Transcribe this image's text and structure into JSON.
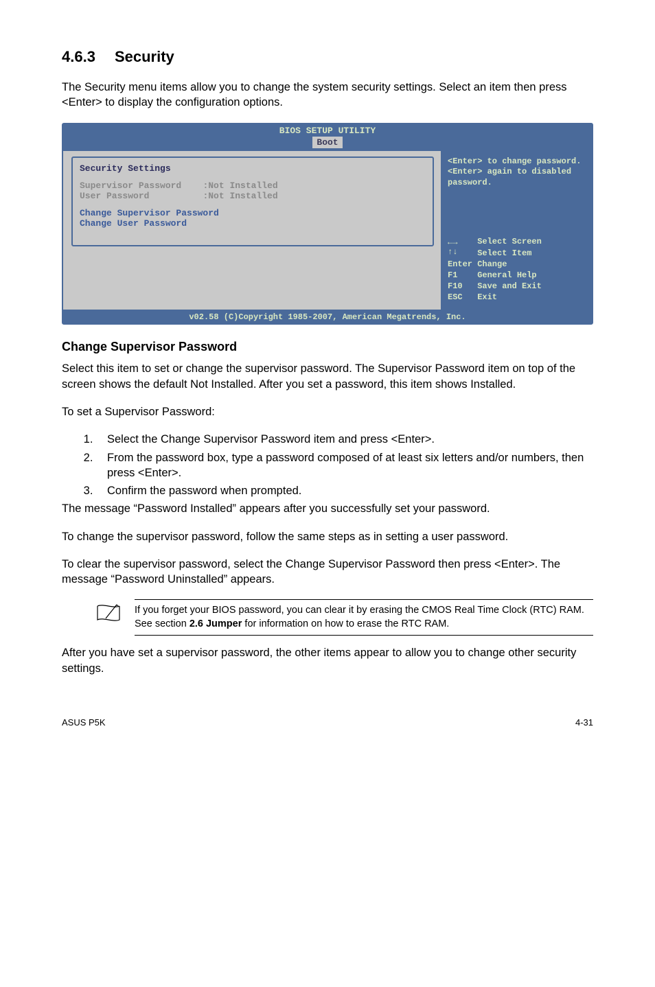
{
  "section": {
    "number": "4.6.3",
    "title": "Security"
  },
  "intro": "The Security menu items allow you to change the system security settings. Select an item then press <Enter> to display the configuration options.",
  "bios": {
    "title": "BIOS SETUP UTILITY",
    "tab": "Boot",
    "left": {
      "heading": "Security Settings",
      "supervisor_label": "Supervisor Password",
      "supervisor_value": ":Not Installed",
      "user_label": "User Password",
      "user_value": ":Not Installed",
      "change_supervisor": "Change Supervisor Password",
      "change_user": "Change User Password"
    },
    "right": {
      "help1": "<Enter> to change password.",
      "help2": "<Enter> again to disabled password.",
      "nav": "      Select Screen\n      Select Item\nEnter Change\nF1    General Help\nF10   Save and Exit\nESC   Exit"
    },
    "footer": "v02.58 (C)Copyright 1985-2007, American Megatrends, Inc."
  },
  "csp_heading": "Change Supervisor Password",
  "csp_p1": "Select this item to set or change the supervisor password. The Supervisor Password item on top of the screen shows the default Not Installed. After you set a password, this item shows Installed.",
  "csp_p2": "To set a Supervisor Password:",
  "steps": {
    "s1": "Select the Change Supervisor Password item and press <Enter>.",
    "s2": "From the password box, type a password composed of at least six letters and/or numbers, then press <Enter>.",
    "s3": "Confirm the password when prompted."
  },
  "after_steps": "The message “Password Installed” appears after you successfully set your password.",
  "p_change": "To change the supervisor password, follow the same steps as in setting a user password.",
  "p_clear": "To clear the supervisor password, select the Change Supervisor Password then press <Enter>. The message “Password Uninstalled” appears.",
  "note_text_parts": {
    "a": "If you forget your BIOS password, you can clear it by erasing the CMOS Real Time Clock (RTC) RAM. See section ",
    "b": "2.6 Jumper",
    "c": " for information on how to erase the RTC RAM."
  },
  "p_after_note": "After you have set a supervisor password, the other items appear to allow you to change other security settings.",
  "footer": {
    "left": "ASUS P5K",
    "right": "4-31"
  }
}
